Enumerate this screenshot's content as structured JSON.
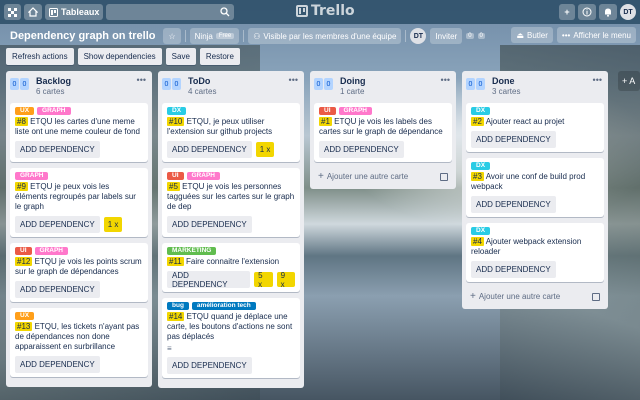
{
  "topbar": {
    "boards_label": "Tableaux",
    "logo_text": "Trello",
    "avatar_initials": "DT"
  },
  "board": {
    "title": "Dependency graph on trello",
    "team": "Ninja",
    "free_badge": "Free",
    "visibility": "Visible par les membres d'une équipe",
    "member_initials": "DT",
    "invite_label": "Inviter",
    "invite_counts": [
      "0",
      "0"
    ],
    "butler_label": "Butler",
    "menu_label": "Afficher le menu"
  },
  "actions": {
    "refresh": "Refresh actions",
    "show_deps": "Show dependencies",
    "save": "Save",
    "restore": "Restore"
  },
  "common": {
    "add_dependency": "ADD DEPENDENCY",
    "add_card": "Ajouter une autre carte",
    "badge_zero": "0"
  },
  "lists": [
    {
      "name": "Backlog",
      "count": "6 cartes",
      "cards": [
        {
          "labels": [
            {
              "text": "UX",
              "color": "#ff9f1a"
            },
            {
              "text": "GRAPH",
              "color": "#ff78cb"
            }
          ],
          "num": "#8",
          "text": " ETQU les cartes d'une meme liste ont une meme couleur de fond",
          "chips": []
        },
        {
          "labels": [
            {
              "text": "GRAPH",
              "color": "#ff78cb"
            }
          ],
          "num": "#9",
          "text": " ETQU je peux vois les éléments regroupés par labels sur le graph",
          "chips": [
            "1 x"
          ]
        },
        {
          "labels": [
            {
              "text": "UI",
              "color": "#eb5a46"
            },
            {
              "text": "GRAPH",
              "color": "#ff78cb"
            }
          ],
          "num": "#12",
          "text": " ETQU je vois les points scrum sur le graph de dépendances",
          "chips": []
        },
        {
          "labels": [
            {
              "text": "UX",
              "color": "#ff9f1a"
            }
          ],
          "num": "#13",
          "text": " ETQU, les tickets n'ayant pas de dépendances non done apparaissent en surbrillance",
          "chips": []
        }
      ]
    },
    {
      "name": "ToDo",
      "count": "4 cartes",
      "cards": [
        {
          "labels": [
            {
              "text": "DX",
              "color": "#29cce5"
            }
          ],
          "num": "#10",
          "text": " ETQU, je peux utiliser l'extension sur github projects",
          "chips": [
            "1 x"
          ]
        },
        {
          "labels": [
            {
              "text": "UI",
              "color": "#eb5a46"
            },
            {
              "text": "GRAPH",
              "color": "#ff78cb"
            }
          ],
          "num": "#5",
          "text": " ETQU je vois les personnes tagguées sur les cartes sur le graph de dep",
          "chips": []
        },
        {
          "labels": [
            {
              "text": "MARKETING",
              "color": "#61bd4f"
            }
          ],
          "num": "#11",
          "text": " Faire connaitre l'extension",
          "chips": [
            "5 x",
            "9 x"
          ]
        },
        {
          "labels": [
            {
              "text": "bug",
              "color": "#0079bf"
            },
            {
              "text": "amélioration tech",
              "color": "#0079bf"
            }
          ],
          "num": "#14",
          "text": " ETQU quand je déplace une carte, les boutons d'actions ne sont pas déplacés",
          "chips": [],
          "desc": true
        }
      ]
    },
    {
      "name": "Doing",
      "count": "1 carte",
      "cards": [
        {
          "labels": [
            {
              "text": "UI",
              "color": "#eb5a46"
            },
            {
              "text": "GRAPH",
              "color": "#ff78cb"
            }
          ],
          "num": "#1",
          "text": " ETQU je vois les labels des cartes sur le graph de dépendance",
          "chips": []
        }
      ]
    },
    {
      "name": "Done",
      "count": "3 cartes",
      "cards": [
        {
          "labels": [
            {
              "text": "DX",
              "color": "#29cce5"
            }
          ],
          "num": "#2",
          "text": " Ajouter react au projet",
          "chips": []
        },
        {
          "labels": [
            {
              "text": "DX",
              "color": "#29cce5"
            }
          ],
          "num": "#3",
          "text": " Avoir une conf de build prod webpack",
          "chips": []
        },
        {
          "labels": [
            {
              "text": "DX",
              "color": "#29cce5"
            }
          ],
          "num": "#4",
          "text": " Ajouter webpack extension reloader",
          "chips": []
        }
      ]
    }
  ],
  "add_list_label": "+ A"
}
